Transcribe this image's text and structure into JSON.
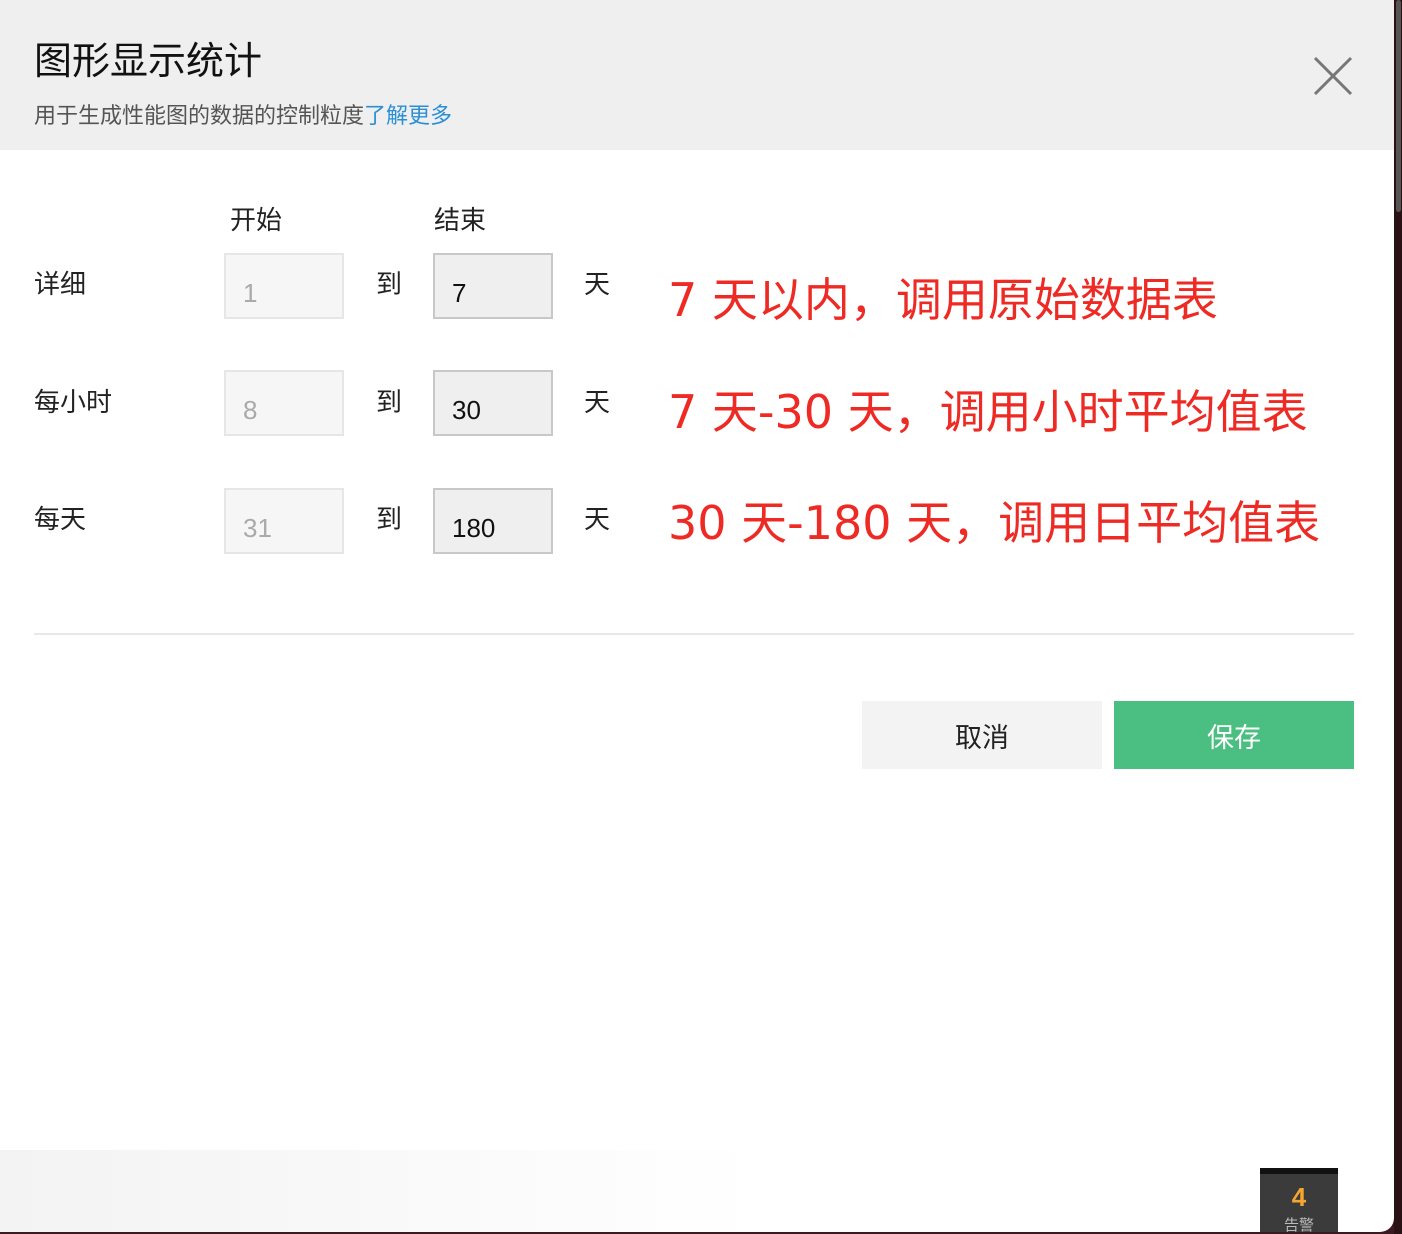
{
  "dialog": {
    "title": "图形显示统计",
    "subtitle": "用于生成性能图的数据的控制粒度",
    "learn_more": "了解更多"
  },
  "columns": {
    "start": "开始",
    "end": "结束"
  },
  "rows": [
    {
      "label": "详细",
      "start": "1",
      "to": "到",
      "end": "7",
      "unit": "天"
    },
    {
      "label": "每小时",
      "start": "8",
      "to": "到",
      "end": "30",
      "unit": "天"
    },
    {
      "label": "每天",
      "start": "31",
      "to": "到",
      "end": "180",
      "unit": "天"
    }
  ],
  "annotations": [
    "7 天以内，调用原始数据表",
    "7 天-30 天，调用小时平均值表",
    "30 天-180 天，调用日平均值表"
  ],
  "buttons": {
    "cancel": "取消",
    "save": "保存"
  },
  "alarm": {
    "count": "4",
    "label": "告警"
  },
  "colors": {
    "accent_green": "#4bbf81",
    "link_blue": "#2b8fd6",
    "annotation_red": "#ee2a24",
    "alarm_orange": "#f5a531"
  }
}
